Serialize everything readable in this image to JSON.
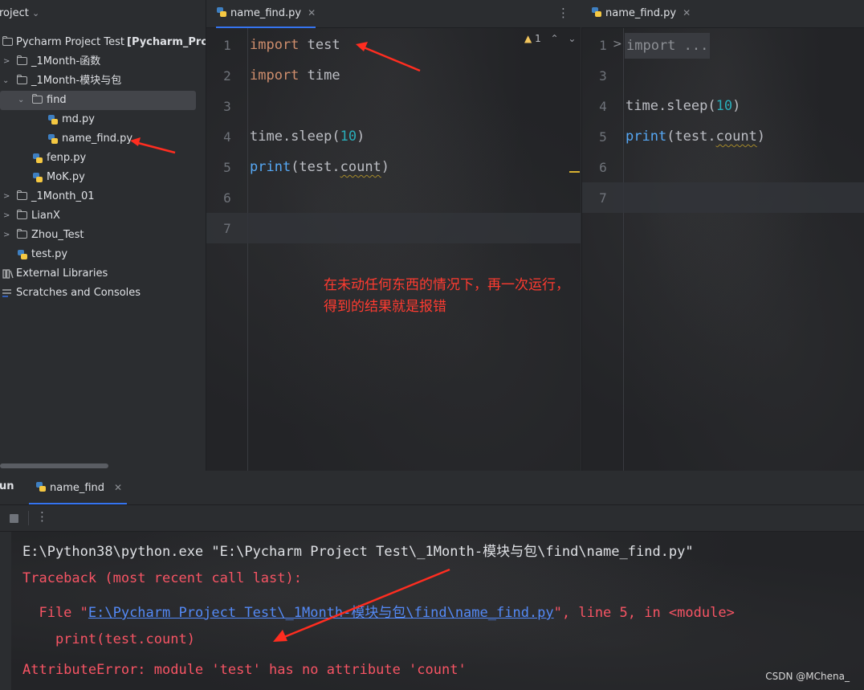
{
  "project_panel": {
    "header": "roject",
    "tree": [
      {
        "label": "Pycharm Project Test",
        "bold_suffix": "[Pycharm_Projec",
        "type": "folder"
      },
      {
        "label": "_1Month-函数",
        "type": "folder"
      },
      {
        "label": "_1Month-模块与包",
        "type": "folder"
      },
      {
        "label": "find",
        "type": "folder"
      },
      {
        "label": "md.py",
        "type": "python"
      },
      {
        "label": "name_find.py",
        "type": "python"
      },
      {
        "label": "fenp.py",
        "type": "python"
      },
      {
        "label": "MoK.py",
        "type": "python"
      },
      {
        "label": "_1Month_01",
        "type": "folder"
      },
      {
        "label": "LianX",
        "type": "folder"
      },
      {
        "label": "Zhou_Test",
        "type": "folder"
      },
      {
        "label": "test.py",
        "type": "python"
      },
      {
        "label": "External Libraries",
        "type": "library"
      },
      {
        "label": "Scratches and Consoles",
        "type": "scratches"
      }
    ]
  },
  "editor_left": {
    "tab": "name_find.py",
    "inspection_count": "1",
    "line_numbers": [
      "1",
      "2",
      "3",
      "4",
      "5",
      "6",
      "7"
    ],
    "lines": {
      "l1_kw": "import",
      "l1_rest": " test",
      "l2_kw": "import",
      "l2_rest": " time",
      "l4_a": "time.sleep(",
      "l4_num": "10",
      "l4_b": ")",
      "l5_fn": "print",
      "l5_a": "(test.",
      "l5_attr": "count",
      "l5_b": ")"
    }
  },
  "editor_right": {
    "tab": "name_find.py",
    "line_numbers": [
      "1",
      "3",
      "4",
      "5",
      "6",
      "7"
    ],
    "folded": "import ...",
    "lines": {
      "l4_a": "time.sleep(",
      "l4_num": "10",
      "l4_b": ")",
      "l5_fn": "print",
      "l5_a": "(test.",
      "l5_attr": "count",
      "l5_b": ")"
    }
  },
  "annotation": {
    "line1": "在未动任何东西的情况下，再一次运行，",
    "line2": "得到的结果就是报错"
  },
  "run_panel": {
    "title": "un",
    "tab": "name_find",
    "console": {
      "cmd": "E:\\Python38\\python.exe \"E:\\Pycharm Project Test\\_1Month-模块与包\\find\\name_find.py\"",
      "traceback": "Traceback (most recent call last):",
      "file_prefix": "  File \"",
      "file_link": "E:\\Pycharm Project Test\\_1Month-模块与包\\find\\name_find.py",
      "file_suffix": "\", line 5, in <module>",
      "code_line": "    print(test.count)",
      "error": "AttributeError: module 'test' has no attribute 'count'"
    }
  },
  "watermark": "CSDN @MChena_",
  "colors": {
    "annotation": "#ff3b30",
    "error": "#f75464",
    "link": "#548af7",
    "keyword": "#cf8e6d",
    "number": "#2aacb8"
  }
}
